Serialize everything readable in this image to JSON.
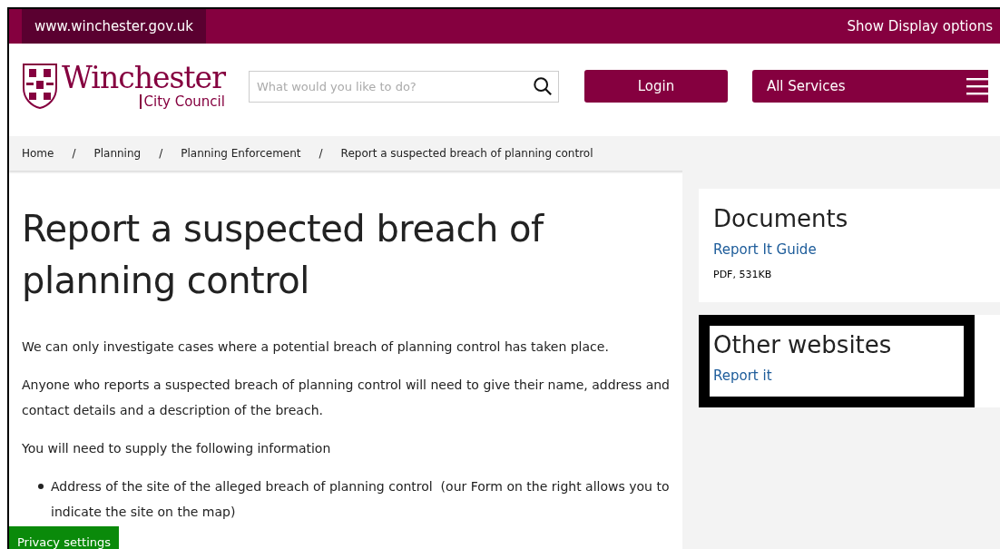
{
  "top_bar": {
    "site_url": "www.winchester.gov.uk",
    "display_options": "Show Display options"
  },
  "header": {
    "logo": {
      "name": "Winchester",
      "subtitle": "City Council"
    },
    "search": {
      "placeholder": "What would you like to do?"
    },
    "login": "Login",
    "all_services": "All Services"
  },
  "breadcrumb": [
    "Home",
    "Planning",
    "Planning Enforcement",
    "Report a suspected breach of planning control"
  ],
  "breadcrumb_separator": "/",
  "main": {
    "title": "Report a suspected breach of planning control",
    "paragraphs": [
      "We can only investigate cases where a potential breach of planning control has taken place.",
      "Anyone who reports a suspected breach of planning control will need to give their name, address and contact details and a description of the breach.",
      "You will need to supply the following information"
    ],
    "bullets": [
      "Address of the site of the alleged breach of planning control  (our Form on the right allows you to indicate the site on the map)"
    ]
  },
  "sidebar": [
    {
      "title": "Documents",
      "highlighted": false,
      "links": [
        {
          "text": "Report It Guide",
          "meta": "PDF, 531KB"
        }
      ]
    },
    {
      "title": "Other websites",
      "highlighted": true,
      "links": [
        {
          "text": "Report it"
        }
      ]
    }
  ],
  "privacy_button": "Privacy settings"
}
